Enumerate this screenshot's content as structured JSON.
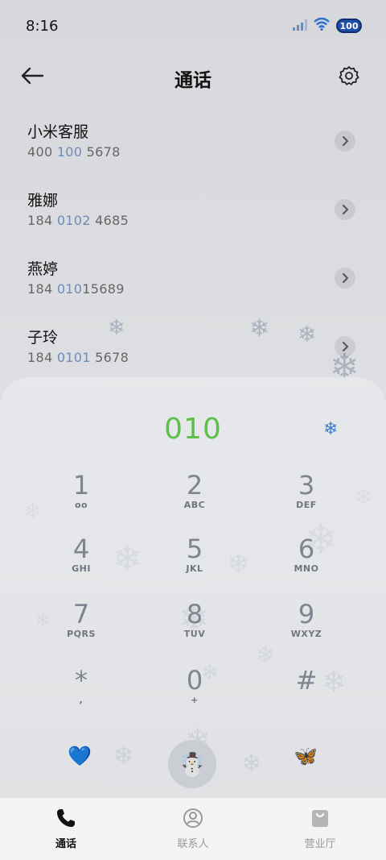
{
  "status_bar": {
    "time": "8:16",
    "battery": "100"
  },
  "header": {
    "title": "通话"
  },
  "contacts": [
    {
      "name": "小米客服",
      "number_pre": "400 ",
      "number_hl": "100",
      "number_post": " 5678"
    },
    {
      "name": "雅娜",
      "number_pre": "184 ",
      "number_hl": "0102",
      "number_post": " 4685"
    },
    {
      "name": "燕婷",
      "number_pre": "184 ",
      "number_hl": "010",
      "number_post": "15689"
    },
    {
      "name": "子玲",
      "number_pre": "184 ",
      "number_hl": "0101",
      "number_post": " 5678"
    }
  ],
  "dialer": {
    "number": "010",
    "keys": [
      {
        "digit": "1",
        "letters": "ᴏᴏ"
      },
      {
        "digit": "2",
        "letters": "ABC"
      },
      {
        "digit": "3",
        "letters": "DEF"
      },
      {
        "digit": "4",
        "letters": "GHI"
      },
      {
        "digit": "5",
        "letters": "JKL"
      },
      {
        "digit": "6",
        "letters": "MNO"
      },
      {
        "digit": "7",
        "letters": "PQRS"
      },
      {
        "digit": "8",
        "letters": "TUV"
      },
      {
        "digit": "9",
        "letters": "WXYZ"
      },
      {
        "digit": "*",
        "letters": ","
      },
      {
        "digit": "0",
        "letters": "+"
      },
      {
        "digit": "#",
        "letters": ""
      }
    ],
    "left_action_icon": "💙",
    "call_icon": "☃️",
    "right_action_icon": "🦋",
    "snow_icon": "❄"
  },
  "tabs": [
    {
      "label": "通话"
    },
    {
      "label": "联系人"
    },
    {
      "label": "营业厅"
    }
  ]
}
